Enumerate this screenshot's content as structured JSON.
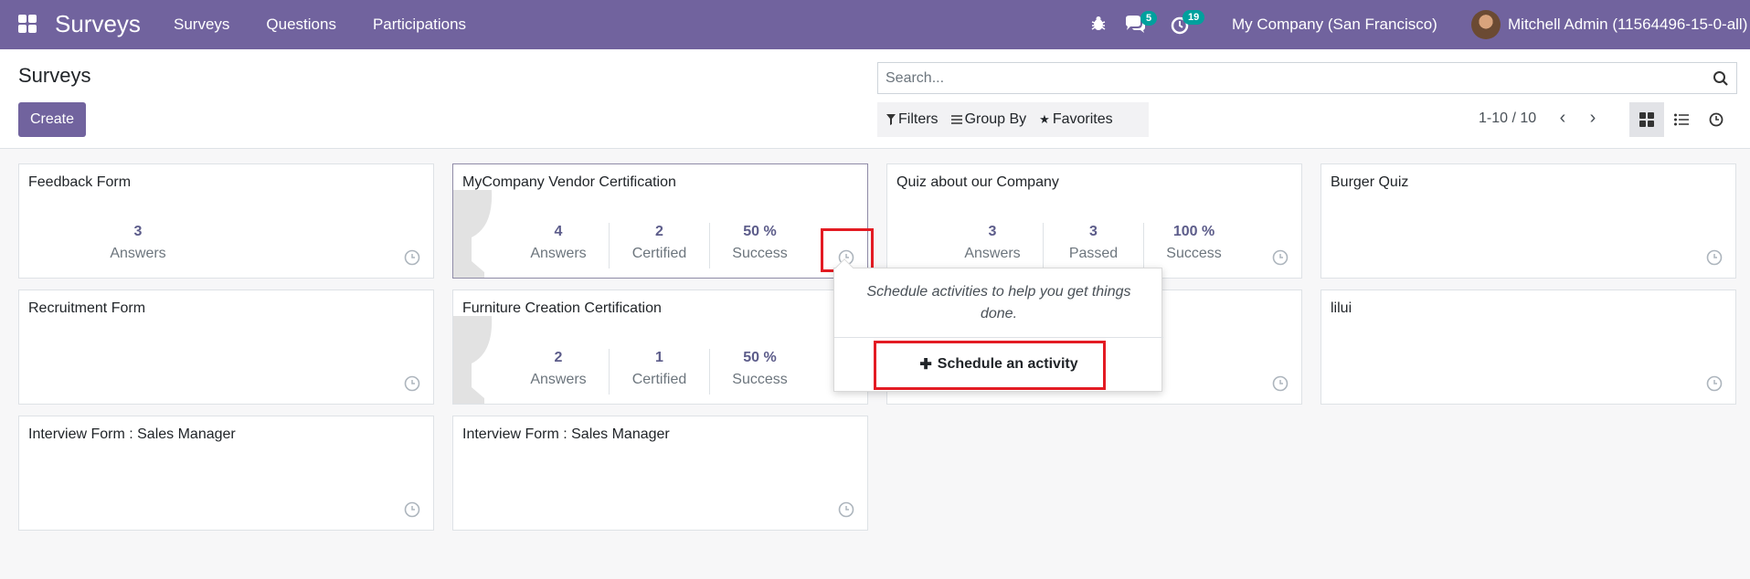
{
  "navbar": {
    "brand": "Surveys",
    "menu": [
      "Surveys",
      "Questions",
      "Participations"
    ],
    "chat_badge": "5",
    "activity_badge": "19",
    "company": "My Company (San Francisco)",
    "user": "Mitchell Admin (11564496-15-0-all)",
    "bg_color": "#71639e"
  },
  "control_panel": {
    "title": "Surveys",
    "create_label": "Create",
    "search_placeholder": "Search...",
    "filters_label": "Filters",
    "group_by_label": "Group By",
    "favorites_label": "Favorites",
    "pager": "1-10 / 10"
  },
  "cards": [
    {
      "title": "Feedback Form",
      "stats": [
        {
          "value": "3",
          "label": "Answers"
        }
      ]
    },
    {
      "title": "MyCompany Vendor Certification",
      "stats": [
        {
          "value": "4",
          "label": "Answers"
        },
        {
          "value": "2",
          "label": "Certified"
        },
        {
          "value": "50 %",
          "label": "Success"
        }
      ]
    },
    {
      "title": "Quiz about our Company",
      "stats": [
        {
          "value": "3",
          "label": "Answers"
        },
        {
          "value": "3",
          "label": "Passed"
        },
        {
          "value": "100 %",
          "label": "Success"
        }
      ]
    },
    {
      "title": "Burger Quiz",
      "stats": []
    },
    {
      "title": "Recruitment Form",
      "stats": []
    },
    {
      "title": "Furniture Creation Certification",
      "stats": [
        {
          "value": "2",
          "label": "Answers"
        },
        {
          "value": "1",
          "label": "Certified"
        },
        {
          "value": "50 %",
          "label": "Success"
        }
      ]
    },
    {
      "title": "lilui",
      "stats": []
    },
    {
      "title": "Interview Form : Sales Manager",
      "stats": []
    },
    {
      "title": "Interview Form : Sales Manager",
      "stats": []
    }
  ],
  "popover": {
    "message": "Schedule activities to help you get things done.",
    "schedule_label": "Schedule an activity"
  },
  "colors": {
    "accent": "#71639e",
    "stat_value": "#5c5c8a",
    "highlight": "#e31b23"
  }
}
